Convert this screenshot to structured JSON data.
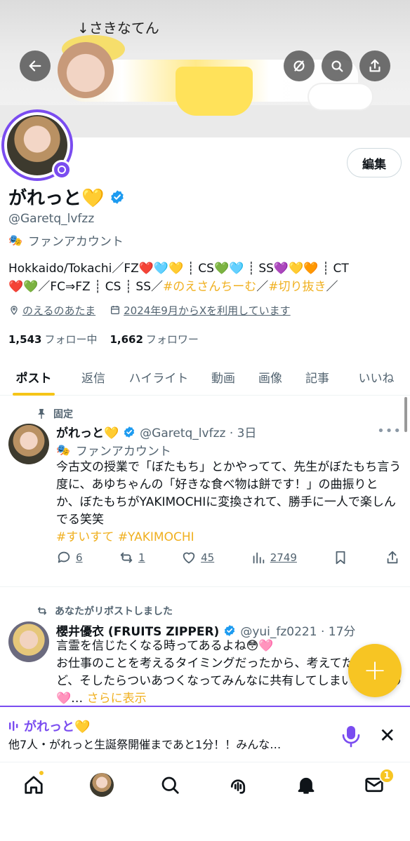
{
  "banner": {
    "caption": "↓さきなてん"
  },
  "header_buttons": {
    "back": "back-arrow-icon",
    "hide": "no-retweet-icon",
    "search": "search-icon",
    "share": "share-icon"
  },
  "profile": {
    "edit_label": "編集",
    "display_name": "がれっと💛",
    "handle": "@Garetq_lvfzz",
    "account_type": "ファンアカウント",
    "bio_line1": "Hokkaido/Tokachi／FZ❤️🩵💛 ┊ CS💚🩵 ┊ SS💜💛🧡 ┊ CT",
    "bio_line2_plain": "❤️💚／FC⇒FZ ┊ CS ┊ SS／",
    "bio_tag1": "#のえさんちーむ",
    "bio_slash": "／",
    "bio_tag2": "#切り抜き",
    "bio_end": "／",
    "location": "のえるのあたま",
    "joined": "2024年9月からXを利用しています",
    "following_count": "1,543",
    "following_label": "フォロー中",
    "followers_count": "1,662",
    "followers_label": "フォロワー"
  },
  "tabs": [
    "ポスト",
    "返信",
    "ハイライト",
    "動画",
    "画像",
    "記事",
    "いいね"
  ],
  "posts": [
    {
      "context": "固定",
      "name": "がれっと💛",
      "handle_time": "@Garetq_lvfzz · 3日",
      "account_type": "ファンアカウント",
      "text": "今古文の授業で「ぼたもち」とかやってて、先生がぼたもち言う度に、あゆちゃんの「好きな食べ物は餅です！」の曲振りとか、ぼたもちがYAKIMOCHIに変換されて、勝手に一人で楽しんでる笑笑",
      "tags": "#すいすて #YAKIMOCHI",
      "replies": "6",
      "reposts": "1",
      "likes": "45",
      "views": "2749"
    },
    {
      "context": "あなたがリポストしました",
      "name": "櫻井優衣 (FRUITS ZIPPER)",
      "handle_time": "@yui_fz0221 · 17分",
      "text_line1": "言霊を信じたくなる時ってあるよね😳🩷",
      "text_line2": "お仕事のことを考えるタイミングだったから、考えてたんだけど、そしたらついあつくなってみんなに共有してしまいました😣🩷…",
      "show_more": "さらに表示"
    }
  ],
  "fab_label": "+",
  "space": {
    "title": "がれっと💛",
    "subtitle": "他7人・がれっと生誕祭開催まであと1分！！みんな…"
  },
  "bottom_nav": {
    "items": [
      "home-icon",
      "profile-avatar",
      "search-icon",
      "communities-icon",
      "notifications-icon",
      "messages-icon"
    ],
    "messages_badge": "1"
  },
  "colors": {
    "accent": "#f7c523",
    "space_purple": "#7a4cf0",
    "verified_blue": "#1d9bf0"
  }
}
